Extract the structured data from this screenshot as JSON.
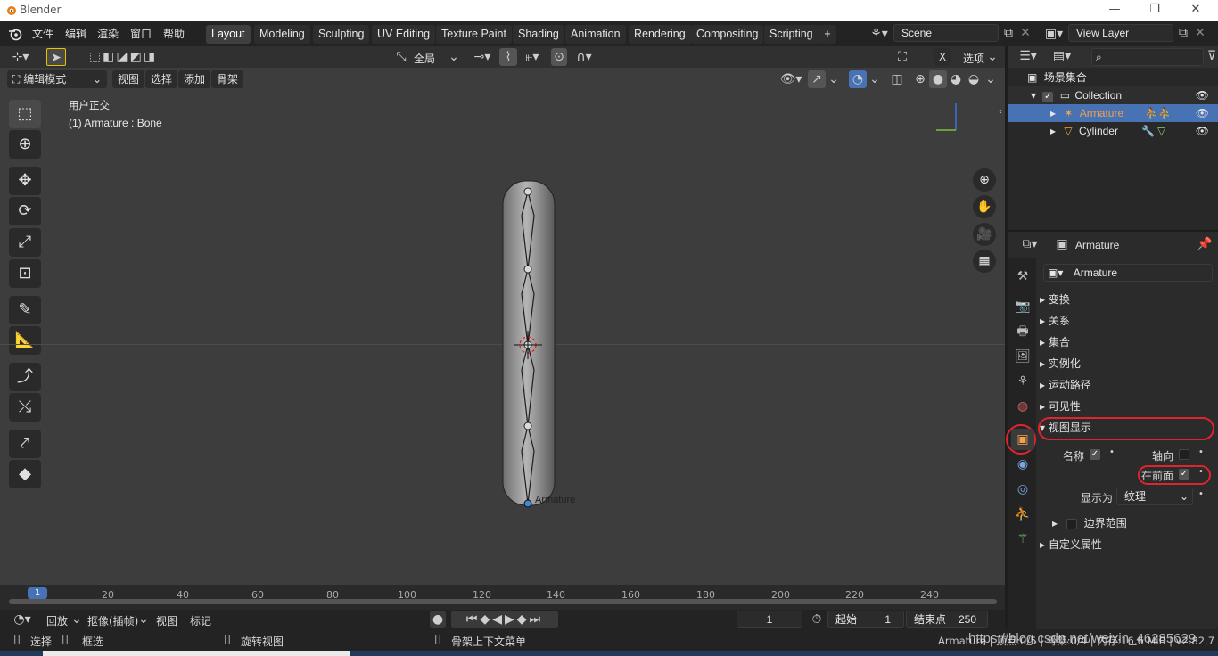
{
  "window": {
    "title": "Blender",
    "controls": {
      "minimize": "—",
      "restore": "❐",
      "close": "✕"
    }
  },
  "menu": [
    "文件",
    "编辑",
    "渲染",
    "窗口",
    "帮助"
  ],
  "workspaces": [
    "Layout",
    "Modeling",
    "Sculpting",
    "UV Editing",
    "Texture Paint",
    "Shading",
    "Animation",
    "Rendering",
    "Compositing",
    "Scripting"
  ],
  "workspace_add": "+",
  "scene": {
    "name": "Scene",
    "view_layer": "View Layer"
  },
  "viewport": {
    "mode": "编辑模式",
    "menus": [
      "视图",
      "选择",
      "添加",
      "骨架"
    ],
    "transform_orientation": "全局",
    "options_label": "选项",
    "x_badge": "X",
    "view_name": "用户正交",
    "object_info": "(1) Armature : Bone",
    "armature_label": "Armature"
  },
  "timeline": {
    "ticks": [
      "1",
      "20",
      "40",
      "60",
      "80",
      "100",
      "120",
      "140",
      "160",
      "180",
      "200",
      "220",
      "240"
    ],
    "playback_menu": "回放",
    "keying_menu": "抠像(插帧)",
    "view_menu": "视图",
    "marker_menu": "标记",
    "current_frame": "1",
    "start_label": "起始",
    "start_value": "1",
    "end_label": "结束点",
    "end_value": "250"
  },
  "statusbar": {
    "select": "选择",
    "box_select": "框选",
    "rotate_view": "旋转视图",
    "context_menu": "骨架上下文菜单",
    "right_info": "Armature | 顶点:0/5 | 骨架:0/4 | 内存:16.6 MiB | v2.82.7",
    "watermark": "https://blog.csdn.net/weixin_46285629"
  },
  "outliner": {
    "root": "场景集合",
    "collection": "Collection",
    "items": [
      {
        "name": "Armature",
        "selected": true
      },
      {
        "name": "Cylinder",
        "selected": false
      }
    ]
  },
  "properties": {
    "header_object": "Armature",
    "object_name": "Armature",
    "sections": [
      "变换",
      "关系",
      "集合",
      "实例化",
      "运动路径",
      "可见性"
    ],
    "viewport_display": {
      "title": "视图显示",
      "name_label": "名称",
      "axes_label": "轴向",
      "in_front_label": "在前面",
      "display_as_label": "显示为",
      "display_as_value": "纹理",
      "bounds_label": "边界范围"
    },
    "custom_props": "自定义属性"
  },
  "colors": {
    "accent_blue": "#4772b3",
    "selected_orange": "#f5a04a",
    "annotation_red": "#e0242d"
  }
}
